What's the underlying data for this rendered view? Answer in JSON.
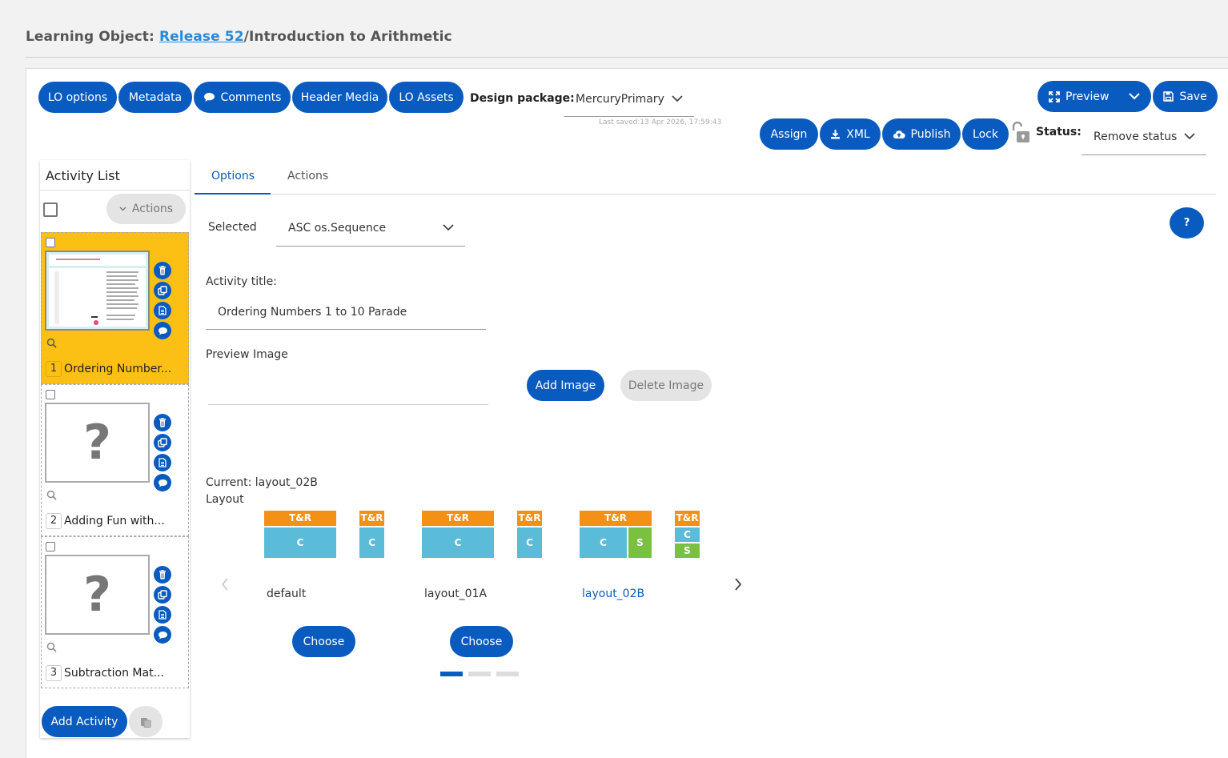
{
  "header": {
    "prefix": "Learning Object:",
    "release_link": "Release 52",
    "path_rest": "/Introduction to Arithmetic"
  },
  "toolbar": {
    "lo_options": "LO options",
    "metadata": "Metadata",
    "comments": "Comments",
    "header_media": "Header Media",
    "lo_assets": "LO Assets",
    "design_package_label": "Design package:",
    "design_package_value": "MercuryPrimary",
    "last_saved": "Last saved:13 Apr 2026, 17:59:43",
    "preview": "Preview",
    "save": "Save",
    "assign": "Assign",
    "xml": "XML",
    "publish": "Publish",
    "lock": "Lock",
    "status_label": "Status:",
    "status_value": "Remove status"
  },
  "activity_list": {
    "title": "Activity List",
    "actions": "Actions",
    "items": [
      {
        "number": "1",
        "title": "Ordering Number...",
        "selected": true
      },
      {
        "number": "2",
        "title": "Adding Fun with...",
        "selected": false
      },
      {
        "number": "3",
        "title": "Subtraction Mat...",
        "selected": false
      }
    ],
    "add_activity": "Add Activity"
  },
  "tabs": {
    "options": "Options",
    "actions": "Actions"
  },
  "options": {
    "selected_label": "Selected",
    "selected_value": "ASC os.Sequence",
    "help": "?",
    "activity_title_label": "Activity title:",
    "activity_title_value": "Ordering Numbers 1 to 10 Parade",
    "preview_image_label": "Preview Image",
    "add_image": "Add Image",
    "delete_image": "Delete Image",
    "current_layout": "Current: layout_02B",
    "layout_label": "Layout",
    "layout_names": [
      "default",
      "layout_01A",
      "layout_02B"
    ],
    "choose": "Choose",
    "block_tr": "T&R",
    "block_c": "C",
    "block_s": "S",
    "carousel_page": 1,
    "carousel_pages": 3
  },
  "colors": {
    "primary": "#0a5bbf",
    "selected_card": "#fcc015",
    "tr_block": "#f39016",
    "c_block": "#5bbcd9",
    "s_block": "#7ac142"
  }
}
